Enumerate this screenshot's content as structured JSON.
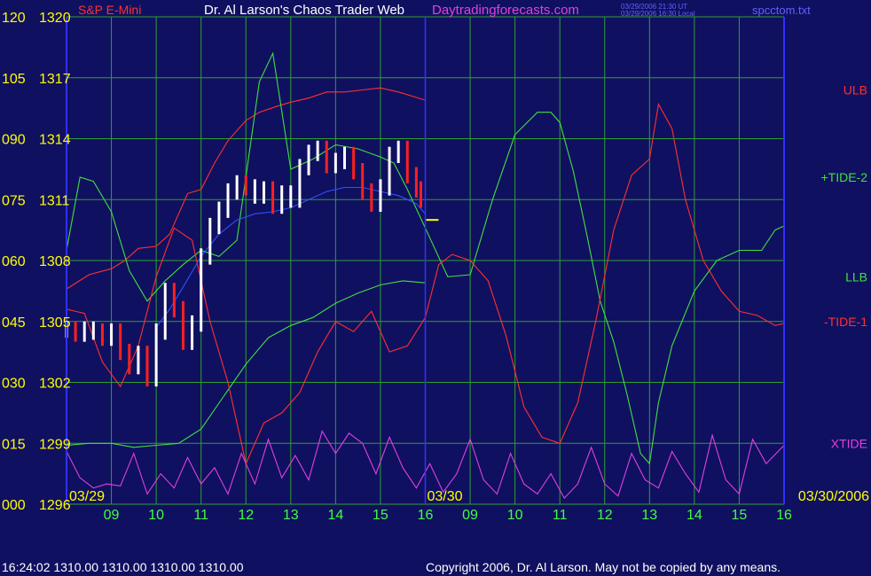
{
  "header": {
    "symbol": "S&P E-Mini",
    "title": "Dr. Al Larson's Chaos Trader Web",
    "site": "Daytradingforecasts.com",
    "stamp_ut": "03/29/2006 21:30 UT",
    "stamp_local": "03/29/2006 16:30 Local",
    "file": "spcctom.txt"
  },
  "footer": {
    "quote": "16:24:02  1310.00 1310.00 1310.00 1310.00",
    "copyright": "Copyright 2006, Dr. Al Larson. May not be copied by any means."
  },
  "colors": {
    "background": "#101060",
    "grid": "#2ea02e",
    "axis": "#3030ff",
    "price_up": "#ffffff",
    "price_down": "#ff2020",
    "ulb": "#ff3030",
    "llb": "#40e040",
    "tide_plus2": "#40e040",
    "tide_minus1": "#ff3030",
    "xtide": "#e040e0",
    "ema": "#3050ff",
    "left_labels": "#ffff00",
    "time_labels": "#40ff40",
    "date_labels": "#ffff00"
  },
  "chart_data": {
    "type": "line",
    "title": "Dr. Al Larson's Chaos Trader Web",
    "left_scale_labels": [
      "120",
      "105",
      "090",
      "075",
      "060",
      "045",
      "030",
      "015",
      "000"
    ],
    "price_labels": [
      "1320",
      "1317",
      "1314",
      "1311",
      "1308",
      "1305",
      "1302",
      "1299",
      "1296"
    ],
    "ylim_price": [
      1296,
      1320
    ],
    "ylim_index": [
      0,
      120
    ],
    "x_hours": [
      "09",
      "10",
      "11",
      "12",
      "13",
      "14",
      "15",
      "16",
      "09",
      "10",
      "11",
      "12",
      "13",
      "14",
      "15",
      "16"
    ],
    "day_labels": [
      "03/29",
      "03/30",
      "03/30/2006"
    ],
    "xlim": [
      0,
      16
    ],
    "day_split": 8,
    "grid": true,
    "last_price": 1310.0,
    "series": [
      {
        "name": "ULB",
        "color": "#ff3030",
        "axis": "price",
        "x": [
          0,
          0.5,
          1,
          1.3,
          1.6,
          2,
          2.3,
          2.7,
          3,
          3.3,
          3.6,
          4,
          4.3,
          4.7,
          5,
          5.4,
          5.8,
          6.2,
          6.6,
          7,
          7.4,
          8
        ],
        "y": [
          1306.6,
          1307.3,
          1307.6,
          1308.0,
          1308.6,
          1308.7,
          1309.3,
          1311.3,
          1311.5,
          1312.8,
          1313.9,
          1314.9,
          1315.3,
          1315.6,
          1315.8,
          1316.0,
          1316.3,
          1316.3,
          1316.4,
          1316.5,
          1316.3,
          1315.9
        ]
      },
      {
        "name": "LLB",
        "color": "#40e040",
        "axis": "price",
        "x": [
          0,
          0.5,
          1,
          1.5,
          2,
          2.5,
          3,
          3.5,
          4,
          4.5,
          5,
          5.5,
          6,
          6.5,
          7,
          7.5,
          8
        ],
        "y": [
          1298.9,
          1299.0,
          1299.0,
          1298.8,
          1298.9,
          1299.0,
          1299.7,
          1301.3,
          1302.9,
          1304.2,
          1304.8,
          1305.2,
          1305.9,
          1306.4,
          1306.8,
          1307.0,
          1306.9
        ]
      },
      {
        "name": "+TIDE-2",
        "color": "#40e040",
        "axis": "price",
        "x": [
          0,
          0.3,
          0.6,
          1,
          1.4,
          1.8,
          2.2,
          2.6,
          3,
          3.4,
          3.8,
          4.3,
          4.6,
          5,
          5.5,
          6,
          6.5,
          7,
          7.3,
          7.6,
          8,
          8.5,
          9,
          9.5,
          10,
          10.5,
          10.8,
          11,
          11.3,
          11.6,
          11.9,
          12.2,
          12.5,
          12.8,
          13,
          13.2,
          13.5,
          14,
          14.5,
          15,
          15.5,
          15.8,
          16
        ],
        "y": [
          1308.5,
          1312.1,
          1311.9,
          1310.4,
          1307.5,
          1306.0,
          1307.0,
          1307.8,
          1308.5,
          1308.2,
          1309.0,
          1316.8,
          1318.2,
          1312.5,
          1313.0,
          1313.7,
          1313.5,
          1313.1,
          1312.8,
          1311.5,
          1309.6,
          1307.2,
          1307.3,
          1311.0,
          1314.2,
          1315.3,
          1315.3,
          1314.8,
          1312.4,
          1309.3,
          1306.0,
          1304.0,
          1301.4,
          1298.5,
          1298.0,
          1301.0,
          1303.8,
          1306.5,
          1308.0,
          1308.5,
          1308.5,
          1309.5,
          1309.7
        ]
      },
      {
        "name": "-TIDE-1",
        "color": "#ff3030",
        "axis": "price",
        "x": [
          0,
          0.4,
          0.8,
          1.2,
          1.6,
          2,
          2.4,
          2.8,
          3.2,
          3.6,
          4,
          4.4,
          4.8,
          5.2,
          5.6,
          6,
          6.4,
          6.8,
          7.2,
          7.6,
          8,
          8.3,
          8.6,
          9,
          9.4,
          9.8,
          10.2,
          10.6,
          11,
          11.4,
          11.8,
          12.2,
          12.6,
          13,
          13.2,
          13.5,
          13.8,
          14.2,
          14.6,
          15,
          15.4,
          15.8,
          16
        ],
        "y": [
          1305.6,
          1305.4,
          1303.0,
          1301.8,
          1303.8,
          1307.2,
          1309.6,
          1309.0,
          1305.0,
          1302.0,
          1298.0,
          1300.0,
          1300.5,
          1301.5,
          1303.5,
          1305.0,
          1304.5,
          1305.5,
          1303.5,
          1303.8,
          1305.2,
          1307.8,
          1308.3,
          1308.0,
          1307.0,
          1304.3,
          1300.8,
          1299.3,
          1299.0,
          1301.0,
          1305.0,
          1309.5,
          1312.2,
          1313.0,
          1315.7,
          1314.5,
          1311.0,
          1308.0,
          1306.5,
          1305.5,
          1305.3,
          1304.8,
          1304.9
        ]
      },
      {
        "name": "XTIDE",
        "color": "#e040e0",
        "axis": "price",
        "x": [
          0,
          0.3,
          0.6,
          0.9,
          1.2,
          1.5,
          1.8,
          2.1,
          2.4,
          2.7,
          3,
          3.3,
          3.6,
          3.9,
          4.2,
          4.5,
          4.8,
          5.1,
          5.4,
          5.7,
          6,
          6.3,
          6.6,
          6.9,
          7.2,
          7.5,
          7.8,
          8.1,
          8.4,
          8.7,
          9,
          9.3,
          9.6,
          9.9,
          10.2,
          10.5,
          10.8,
          11.1,
          11.4,
          11.7,
          12,
          12.3,
          12.6,
          12.9,
          13.2,
          13.5,
          13.8,
          14.1,
          14.4,
          14.7,
          15,
          15.3,
          15.6,
          16
        ],
        "y": [
          1298.6,
          1297.3,
          1296.8,
          1297.0,
          1296.9,
          1298.5,
          1296.5,
          1297.5,
          1296.8,
          1298.3,
          1297.0,
          1297.8,
          1296.5,
          1298.5,
          1297.0,
          1299.2,
          1297.3,
          1298.4,
          1297.2,
          1299.6,
          1298.5,
          1299.5,
          1299.0,
          1297.5,
          1299.3,
          1297.8,
          1296.8,
          1298.0,
          1296.6,
          1297.5,
          1299.2,
          1297.2,
          1296.5,
          1298.5,
          1297.0,
          1296.5,
          1297.5,
          1296.3,
          1297.0,
          1298.8,
          1297.0,
          1296.4,
          1298.5,
          1297.2,
          1296.8,
          1298.6,
          1297.5,
          1296.6,
          1299.4,
          1297.2,
          1296.5,
          1299.2,
          1298.0,
          1298.9
        ]
      },
      {
        "name": "EMA",
        "color": "#3050ff",
        "axis": "price",
        "x": [
          2,
          2.3,
          2.6,
          3,
          3.4,
          3.8,
          4.2,
          4.6,
          5,
          5.4,
          5.8,
          6.2,
          6.6,
          7,
          7.4,
          7.8,
          8
        ],
        "y": [
          1304.7,
          1305.6,
          1306.7,
          1308.2,
          1309.3,
          1310.0,
          1310.3,
          1310.4,
          1310.6,
          1311.0,
          1311.4,
          1311.6,
          1311.6,
          1311.4,
          1311.2,
          1310.8,
          1310.3
        ]
      }
    ],
    "price_bars": {
      "x": [
        0,
        0.2,
        0.4,
        0.6,
        0.8,
        1,
        1.2,
        1.4,
        1.6,
        1.8,
        2,
        2.2,
        2.4,
        2.6,
        2.8,
        3,
        3.2,
        3.4,
        3.6,
        3.8,
        4,
        4.2,
        4.4,
        4.6,
        4.8,
        5,
        5.2,
        5.4,
        5.6,
        5.8,
        6,
        6.2,
        6.4,
        6.6,
        6.8,
        7,
        7.2,
        7.4,
        7.6,
        7.8,
        7.9
      ],
      "close": [
        1304.6,
        1304.4,
        1304.6,
        1304.5,
        1304.2,
        1304.5,
        1303.5,
        1302.8,
        1303.4,
        1302.2,
        1304.5,
        1306.5,
        1305.6,
        1304.0,
        1304.9,
        1308.2,
        1309.7,
        1310.5,
        1311.4,
        1311.8,
        1311.6,
        1311.2,
        1311.5,
        1310.7,
        1311.3,
        1311.0,
        1312.6,
        1313.3,
        1313.5,
        1312.7,
        1312.9,
        1313.2,
        1312.4,
        1311.4,
        1310.8,
        1311.6,
        1313.2,
        1313.5,
        1312.2,
        1311.5,
        1311.0
      ],
      "dir": [
        "u",
        "d",
        "u",
        "u",
        "d",
        "u",
        "d",
        "d",
        "u",
        "d",
        "u",
        "u",
        "d",
        "d",
        "u",
        "u",
        "u",
        "u",
        "u",
        "u",
        "d",
        "u",
        "u",
        "d",
        "u",
        "u",
        "u",
        "u",
        "u",
        "d",
        "u",
        "u",
        "d",
        "d",
        "d",
        "u",
        "u",
        "u",
        "d",
        "d",
        "d"
      ]
    },
    "right_labels": [
      {
        "name": "ULB",
        "color": "#ff3030",
        "y": 1316.4
      },
      {
        "name": "+TIDE-2",
        "color": "#40e040",
        "y": 1312.1
      },
      {
        "name": "LLB",
        "color": "#40e040",
        "y": 1307.2
      },
      {
        "name": "-TIDE-1",
        "color": "#ff3030",
        "y": 1305.0
      },
      {
        "name": "XTIDE",
        "color": "#e040e0",
        "y": 1299.0
      }
    ]
  }
}
